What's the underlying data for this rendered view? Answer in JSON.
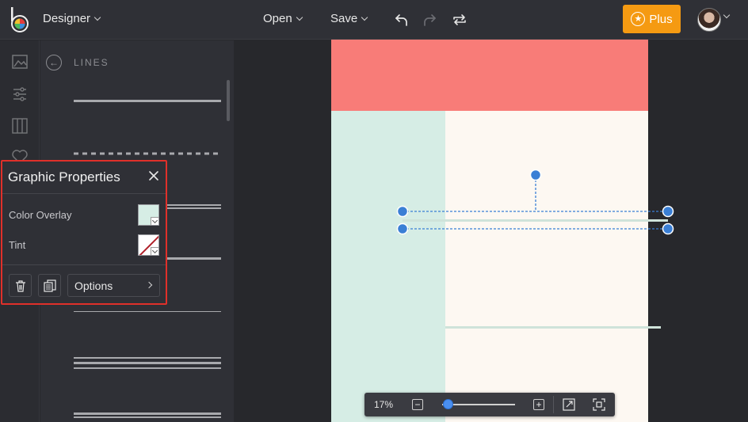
{
  "header": {
    "app_menu_label": "Designer",
    "open_label": "Open",
    "save_label": "Save",
    "plus_label": "Plus"
  },
  "lines_panel": {
    "title": "LINES"
  },
  "graphic_properties": {
    "title": "Graphic Properties",
    "color_overlay_label": "Color Overlay",
    "color_overlay_value": "#d6ede5",
    "tint_label": "Tint",
    "options_label": "Options"
  },
  "zoom": {
    "level_label": "17%",
    "level_fraction": 0.08
  },
  "colors": {
    "accent": "#f59a12",
    "selection": "#3a7fd5",
    "highlight_border": "#e0302a",
    "page_header": "#f87c78",
    "page_sidebar": "#d6ede5",
    "page_body": "#fdf8f2"
  },
  "icons": [
    "logo-icon",
    "chevron-down-icon",
    "undo-icon",
    "redo-icon",
    "repeat-icon",
    "star-icon",
    "image-icon",
    "sliders-icon",
    "columns-icon",
    "heart-icon",
    "back-arrow-icon",
    "close-icon",
    "trash-icon",
    "duplicate-icon",
    "zoom-out-icon",
    "zoom-in-icon",
    "expand-icon",
    "fit-screen-icon"
  ]
}
